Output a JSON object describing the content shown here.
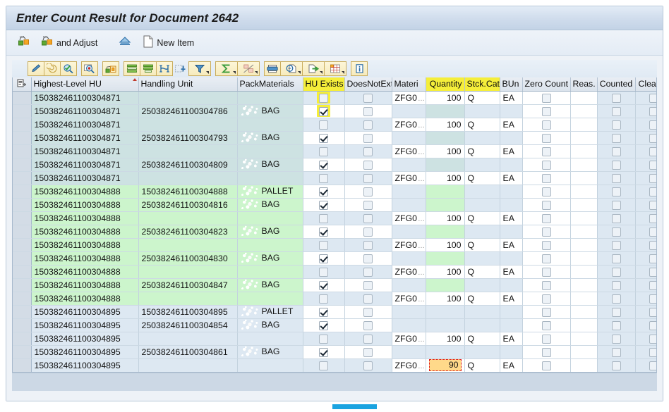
{
  "window": {
    "title": "Enter Count Result for Document 2642"
  },
  "action_toolbar": {
    "items": [
      {
        "name": "count-button",
        "label": "",
        "icon": "count-icon"
      },
      {
        "name": "count-and-adjust-button",
        "label": "and Adjust",
        "icon": "count-adjust-icon"
      },
      {
        "name": "upload-button",
        "label": "",
        "icon": "upload-arrow-icon"
      },
      {
        "name": "new-item-button",
        "label": "New Item",
        "icon": "new-document-icon"
      }
    ]
  },
  "grid_toolbar": {
    "buttons": [
      {
        "name": "edit-pencil-icon",
        "tip": "Change"
      },
      {
        "name": "spiral-icon",
        "tip": "Display"
      },
      {
        "name": "check-magnifier-icon",
        "tip": "Check"
      },
      {
        "name": "find-magnifier-icon",
        "tip": "Find"
      },
      {
        "name": "detail-icon",
        "tip": "Detail"
      },
      {
        "name": "insert-row-above-icon",
        "tip": "Insert Row"
      },
      {
        "name": "insert-row-below-icon",
        "tip": "Append Row"
      },
      {
        "name": "sort-icon",
        "tip": "Sort"
      },
      {
        "name": "set-filter-icon",
        "tip": "Set Filter"
      },
      {
        "name": "filter-icon",
        "tip": "Filter"
      },
      {
        "name": "sum-icon",
        "tip": "Total"
      },
      {
        "name": "subtotal-icon",
        "tip": "Subtotals"
      },
      {
        "name": "print-icon",
        "tip": "Print"
      },
      {
        "name": "print-preview-icon",
        "tip": "Print Preview"
      },
      {
        "name": "export-icon",
        "tip": "Export"
      },
      {
        "name": "layout-icon",
        "tip": "Layout"
      },
      {
        "name": "info-icon",
        "tip": "Information"
      }
    ]
  },
  "table": {
    "columns": [
      {
        "key": "sel",
        "label": "",
        "width": 26,
        "align": "center",
        "highlight": false
      },
      {
        "key": "highest_hu",
        "label": "Highest-Level HU",
        "width": 152,
        "align": "left",
        "highlight": false,
        "sorted": true
      },
      {
        "key": "handling",
        "label": "Handling Unit",
        "width": 140,
        "align": "left",
        "highlight": false
      },
      {
        "key": "packmat",
        "label": "PackMaterials",
        "width": 93,
        "align": "left",
        "highlight": false
      },
      {
        "key": "hu_exists",
        "label": "HU Exists",
        "width": 59,
        "align": "center",
        "highlight": true
      },
      {
        "key": "does_not",
        "label": "DoesNotExt",
        "width": 67,
        "align": "center",
        "highlight": false
      },
      {
        "key": "materi",
        "label": "Materi",
        "width": 48,
        "align": "left",
        "highlight": false
      },
      {
        "key": "quantity",
        "label": "Quantity",
        "width": 55,
        "align": "right",
        "highlight": true
      },
      {
        "key": "stck_cat",
        "label": "Stck.Cat.",
        "width": 50,
        "align": "left",
        "highlight": true
      },
      {
        "key": "bun",
        "label": "BUn",
        "width": 32,
        "align": "left",
        "highlight": false
      },
      {
        "key": "zero_count",
        "label": "Zero Count",
        "width": 68,
        "align": "center",
        "highlight": false
      },
      {
        "key": "reas",
        "label": "Reas.",
        "width": 38,
        "align": "left",
        "highlight": false
      },
      {
        "key": "counted",
        "label": "Counted",
        "width": 54,
        "align": "center",
        "highlight": false
      },
      {
        "key": "cleared",
        "label": "Cleared",
        "width": 52,
        "align": "center",
        "highlight": false
      }
    ],
    "rows": [
      {
        "group": "teal",
        "highest_hu": "150382461100304871",
        "handling": "",
        "packmat": "",
        "hu_exists": false,
        "hu_exists_highlight": true,
        "does_not": false,
        "materi": "ZFG0",
        "quantity": "100",
        "stck_cat": "Q",
        "bun": "EA",
        "zero_count": false,
        "reas": "",
        "counted": false,
        "cleared": false,
        "value_cells_white": true
      },
      {
        "group": "teal",
        "highest_hu": "150382461100304871",
        "handling": "250382461100304786",
        "packmat": "BAG",
        "hu_exists": true,
        "hu_exists_highlight": true,
        "does_not": false,
        "materi": "",
        "quantity": "",
        "stck_cat": "",
        "bun": "",
        "zero_count": false,
        "reas": "",
        "counted": false,
        "cleared": false,
        "value_cells_white": false
      },
      {
        "group": "teal",
        "highest_hu": "150382461100304871",
        "handling": "",
        "packmat": "",
        "hu_exists": false,
        "hu_exists_highlight": false,
        "does_not": false,
        "materi": "ZFG0",
        "quantity": "100",
        "stck_cat": "Q",
        "bun": "EA",
        "zero_count": false,
        "reas": "",
        "counted": false,
        "cleared": false,
        "value_cells_white": true
      },
      {
        "group": "teal",
        "highest_hu": "150382461100304871",
        "handling": "250382461100304793",
        "packmat": "BAG",
        "hu_exists": true,
        "hu_exists_highlight": false,
        "does_not": false,
        "materi": "",
        "quantity": "",
        "stck_cat": "",
        "bun": "",
        "zero_count": false,
        "reas": "",
        "counted": false,
        "cleared": false,
        "value_cells_white": false
      },
      {
        "group": "teal",
        "highest_hu": "150382461100304871",
        "handling": "",
        "packmat": "",
        "hu_exists": false,
        "hu_exists_highlight": false,
        "does_not": false,
        "materi": "ZFG0",
        "quantity": "100",
        "stck_cat": "Q",
        "bun": "EA",
        "zero_count": false,
        "reas": "",
        "counted": false,
        "cleared": false,
        "value_cells_white": true
      },
      {
        "group": "teal",
        "highest_hu": "150382461100304871",
        "handling": "250382461100304809",
        "packmat": "BAG",
        "hu_exists": true,
        "hu_exists_highlight": false,
        "does_not": false,
        "materi": "",
        "quantity": "",
        "stck_cat": "",
        "bun": "",
        "zero_count": false,
        "reas": "",
        "counted": false,
        "cleared": false,
        "value_cells_white": false
      },
      {
        "group": "teal",
        "highest_hu": "150382461100304871",
        "handling": "",
        "packmat": "",
        "hu_exists": false,
        "hu_exists_highlight": false,
        "does_not": false,
        "materi": "ZFG0",
        "quantity": "100",
        "stck_cat": "Q",
        "bun": "EA",
        "zero_count": false,
        "reas": "",
        "counted": false,
        "cleared": false,
        "value_cells_white": true
      },
      {
        "group": "green",
        "highest_hu": "150382461100304888",
        "handling": "150382461100304888",
        "packmat": "PALLET",
        "hu_exists": true,
        "hu_exists_highlight": false,
        "does_not": false,
        "materi": "",
        "quantity": "",
        "stck_cat": "",
        "bun": "",
        "zero_count": false,
        "reas": "",
        "counted": false,
        "cleared": false,
        "value_cells_white": false
      },
      {
        "group": "green",
        "highest_hu": "150382461100304888",
        "handling": "250382461100304816",
        "packmat": "BAG",
        "hu_exists": true,
        "hu_exists_highlight": false,
        "does_not": false,
        "materi": "",
        "quantity": "",
        "stck_cat": "",
        "bun": "",
        "zero_count": false,
        "reas": "",
        "counted": false,
        "cleared": false,
        "value_cells_white": false
      },
      {
        "group": "green",
        "highest_hu": "150382461100304888",
        "handling": "",
        "packmat": "",
        "hu_exists": false,
        "hu_exists_highlight": false,
        "does_not": false,
        "materi": "ZFG0",
        "quantity": "100",
        "stck_cat": "Q",
        "bun": "EA",
        "zero_count": false,
        "reas": "",
        "counted": false,
        "cleared": false,
        "value_cells_white": true
      },
      {
        "group": "green",
        "highest_hu": "150382461100304888",
        "handling": "250382461100304823",
        "packmat": "BAG",
        "hu_exists": true,
        "hu_exists_highlight": false,
        "does_not": false,
        "materi": "",
        "quantity": "",
        "stck_cat": "",
        "bun": "",
        "zero_count": false,
        "reas": "",
        "counted": false,
        "cleared": false,
        "value_cells_white": false
      },
      {
        "group": "green",
        "highest_hu": "150382461100304888",
        "handling": "",
        "packmat": "",
        "hu_exists": false,
        "hu_exists_highlight": false,
        "does_not": false,
        "materi": "ZFG0",
        "quantity": "100",
        "stck_cat": "Q",
        "bun": "EA",
        "zero_count": false,
        "reas": "",
        "counted": false,
        "cleared": false,
        "value_cells_white": true
      },
      {
        "group": "green",
        "highest_hu": "150382461100304888",
        "handling": "250382461100304830",
        "packmat": "BAG",
        "hu_exists": true,
        "hu_exists_highlight": false,
        "does_not": false,
        "materi": "",
        "quantity": "",
        "stck_cat": "",
        "bun": "",
        "zero_count": false,
        "reas": "",
        "counted": false,
        "cleared": false,
        "value_cells_white": false
      },
      {
        "group": "green",
        "highest_hu": "150382461100304888",
        "handling": "",
        "packmat": "",
        "hu_exists": false,
        "hu_exists_highlight": false,
        "does_not": false,
        "materi": "ZFG0",
        "quantity": "100",
        "stck_cat": "Q",
        "bun": "EA",
        "zero_count": false,
        "reas": "",
        "counted": false,
        "cleared": false,
        "value_cells_white": true
      },
      {
        "group": "green",
        "highest_hu": "150382461100304888",
        "handling": "250382461100304847",
        "packmat": "BAG",
        "hu_exists": true,
        "hu_exists_highlight": false,
        "does_not": false,
        "materi": "",
        "quantity": "",
        "stck_cat": "",
        "bun": "",
        "zero_count": false,
        "reas": "",
        "counted": false,
        "cleared": false,
        "value_cells_white": false
      },
      {
        "group": "green",
        "highest_hu": "150382461100304888",
        "handling": "",
        "packmat": "",
        "hu_exists": false,
        "hu_exists_highlight": false,
        "does_not": false,
        "materi": "ZFG0",
        "quantity": "100",
        "stck_cat": "Q",
        "bun": "EA",
        "zero_count": false,
        "reas": "",
        "counted": false,
        "cleared": false,
        "value_cells_white": true
      },
      {
        "group": "blue",
        "highest_hu": "150382461100304895",
        "handling": "150382461100304895",
        "packmat": "PALLET",
        "hu_exists": true,
        "hu_exists_highlight": false,
        "does_not": false,
        "materi": "",
        "quantity": "",
        "stck_cat": "",
        "bun": "",
        "zero_count": false,
        "reas": "",
        "counted": false,
        "cleared": false,
        "value_cells_white": false
      },
      {
        "group": "blue",
        "highest_hu": "150382461100304895",
        "handling": "250382461100304854",
        "packmat": "BAG",
        "hu_exists": true,
        "hu_exists_highlight": false,
        "does_not": false,
        "materi": "",
        "quantity": "",
        "stck_cat": "",
        "bun": "",
        "zero_count": false,
        "reas": "",
        "counted": false,
        "cleared": false,
        "value_cells_white": false
      },
      {
        "group": "blue",
        "highest_hu": "150382461100304895",
        "handling": "",
        "packmat": "",
        "hu_exists": false,
        "hu_exists_highlight": false,
        "does_not": false,
        "materi": "ZFG0",
        "quantity": "100",
        "stck_cat": "Q",
        "bun": "EA",
        "zero_count": false,
        "reas": "",
        "counted": false,
        "cleared": false,
        "value_cells_white": true
      },
      {
        "group": "blue",
        "highest_hu": "150382461100304895",
        "handling": "250382461100304861",
        "packmat": "BAG",
        "hu_exists": true,
        "hu_exists_highlight": false,
        "does_not": false,
        "materi": "",
        "quantity": "",
        "stck_cat": "",
        "bun": "",
        "zero_count": false,
        "reas": "",
        "counted": false,
        "cleared": false,
        "value_cells_white": false
      },
      {
        "group": "blue",
        "highest_hu": "150382461100304895",
        "handling": "",
        "packmat": "",
        "hu_exists": false,
        "hu_exists_highlight": false,
        "does_not": false,
        "materi": "ZFG0",
        "quantity": "90",
        "stck_cat": "Q",
        "bun": "EA",
        "zero_count": false,
        "reas": "",
        "counted": false,
        "cleared": false,
        "value_cells_white": true,
        "quantity_editing": true
      }
    ]
  },
  "colors": {
    "title_bg": "#cfdcec",
    "highlight_yellow": "#f5ee3a",
    "group_teal": "#cde2e2",
    "group_green": "#ccf5cc",
    "group_blue": "#dde8f2",
    "edit_field_bg": "#ffd98a",
    "edit_field_border": "#e02020",
    "accent_blue": "#1aa3e0"
  }
}
